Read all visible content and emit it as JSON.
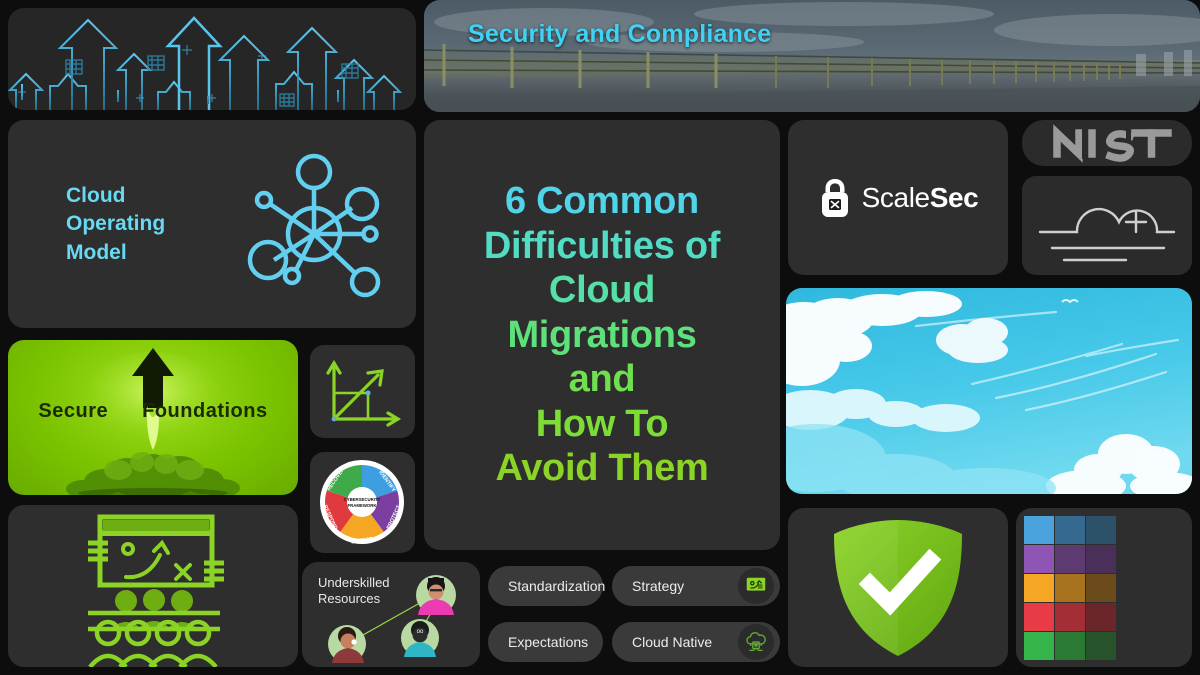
{
  "theme": {
    "background": "#0d0d0d",
    "card_bg": "#2e2e2e",
    "accent_cyan": "#3fd2f5",
    "accent_green": "#8bd425",
    "text_light": "#ececec"
  },
  "hero": {
    "title": "Security and Compliance",
    "title_color": "#3fd2f5"
  },
  "arrows_panel": {
    "icon": "upward-arrows-graphic",
    "color": "#3aa9d6"
  },
  "cloud_operating_model": {
    "title_line1": "Cloud",
    "title_line2": "Operating",
    "title_line3": "Model",
    "title_color": "#68d9f2",
    "icon": "hub-and-spoke-network-icon"
  },
  "secure_foundations": {
    "word1": "Secure",
    "word2": "Foundations",
    "bg_color": "#8bd41c",
    "icon": "rocket-arrow-launch-graphic"
  },
  "chart_icon_card": {
    "icon": "growth-line-chart-icon",
    "color": "#8bd425"
  },
  "csf_wheel": {
    "center_line1": "CYBERSECURITY",
    "center_line2": "FRAMEWORK",
    "segments": [
      {
        "label": "IDENTIFY",
        "color": "#3d9fe0"
      },
      {
        "label": "PROTECT",
        "color": "#7a3fa0"
      },
      {
        "label": "DETECT",
        "color": "#f5a623"
      },
      {
        "label": "RESPOND",
        "color": "#e03a3e"
      },
      {
        "label": "RECOVER",
        "color": "#3faa4a"
      }
    ]
  },
  "team_card": {
    "icon": "strategy-board-with-team-icon",
    "color": "#8bd425"
  },
  "main_title": {
    "lines": [
      {
        "text": "6 Common",
        "color": "#4fd4e8"
      },
      {
        "text": "Difficulties of",
        "color": "#52dcc4"
      },
      {
        "text": "Cloud",
        "color": "#56dfa6"
      },
      {
        "text": "Migrations",
        "color": "#5ee07a"
      },
      {
        "text": "and",
        "color": "#6fe04e"
      },
      {
        "text": "How To",
        "color": "#7ddd36"
      },
      {
        "text": "Avoid Them",
        "color": "#8bd425"
      }
    ]
  },
  "people_card": {
    "label_line1": "Underskilled",
    "label_line2": "Resources",
    "avatars": [
      "avatar-woman-pink",
      "avatar-man-dark",
      "avatar-person-teal"
    ]
  },
  "pills": [
    {
      "label": "Standardization",
      "icon": null,
      "icon_color": null
    },
    {
      "label": "Strategy",
      "icon": "strategy-board-icon",
      "icon_color": "#8bd425"
    },
    {
      "label": "Expectations",
      "icon": null,
      "icon_color": null
    },
    {
      "label": "Cloud Native",
      "icon": "cloud-chip-icon",
      "icon_color": "#4e8f2a"
    }
  ],
  "scalesec": {
    "name_light": "Scale",
    "name_bold": "Sec",
    "icon": "padlock-logo-icon"
  },
  "nist": {
    "wordmark": "NIST",
    "color": "#9a9a9a"
  },
  "cloud_plus": {
    "icon": "cloud-plus-outline-icon",
    "color": "#cfcfcf"
  },
  "sky_card": {
    "image": "blue-sky-with-clouds-photo",
    "sky_color": "#3fc6e8",
    "cloud_color": "#ffffff"
  },
  "shield_card": {
    "icon": "green-shield-check-icon",
    "shield_color": "#7cc41f",
    "check_color": "#ffffff"
  },
  "swatches": {
    "rows": [
      {
        "name": "blue",
        "colors": [
          "#4aa3dd",
          "#36698f",
          "#2c5169"
        ]
      },
      {
        "name": "purple",
        "colors": [
          "#8e55b5",
          "#5d3a70",
          "#4a2f58"
        ]
      },
      {
        "name": "orange",
        "colors": [
          "#f5a623",
          "#a8731f",
          "#6b4a1c"
        ]
      },
      {
        "name": "red",
        "colors": [
          "#e93b45",
          "#a32e36",
          "#6b262b"
        ]
      },
      {
        "name": "green",
        "colors": [
          "#34b44a",
          "#2a7a36",
          "#28542c"
        ]
      }
    ]
  }
}
